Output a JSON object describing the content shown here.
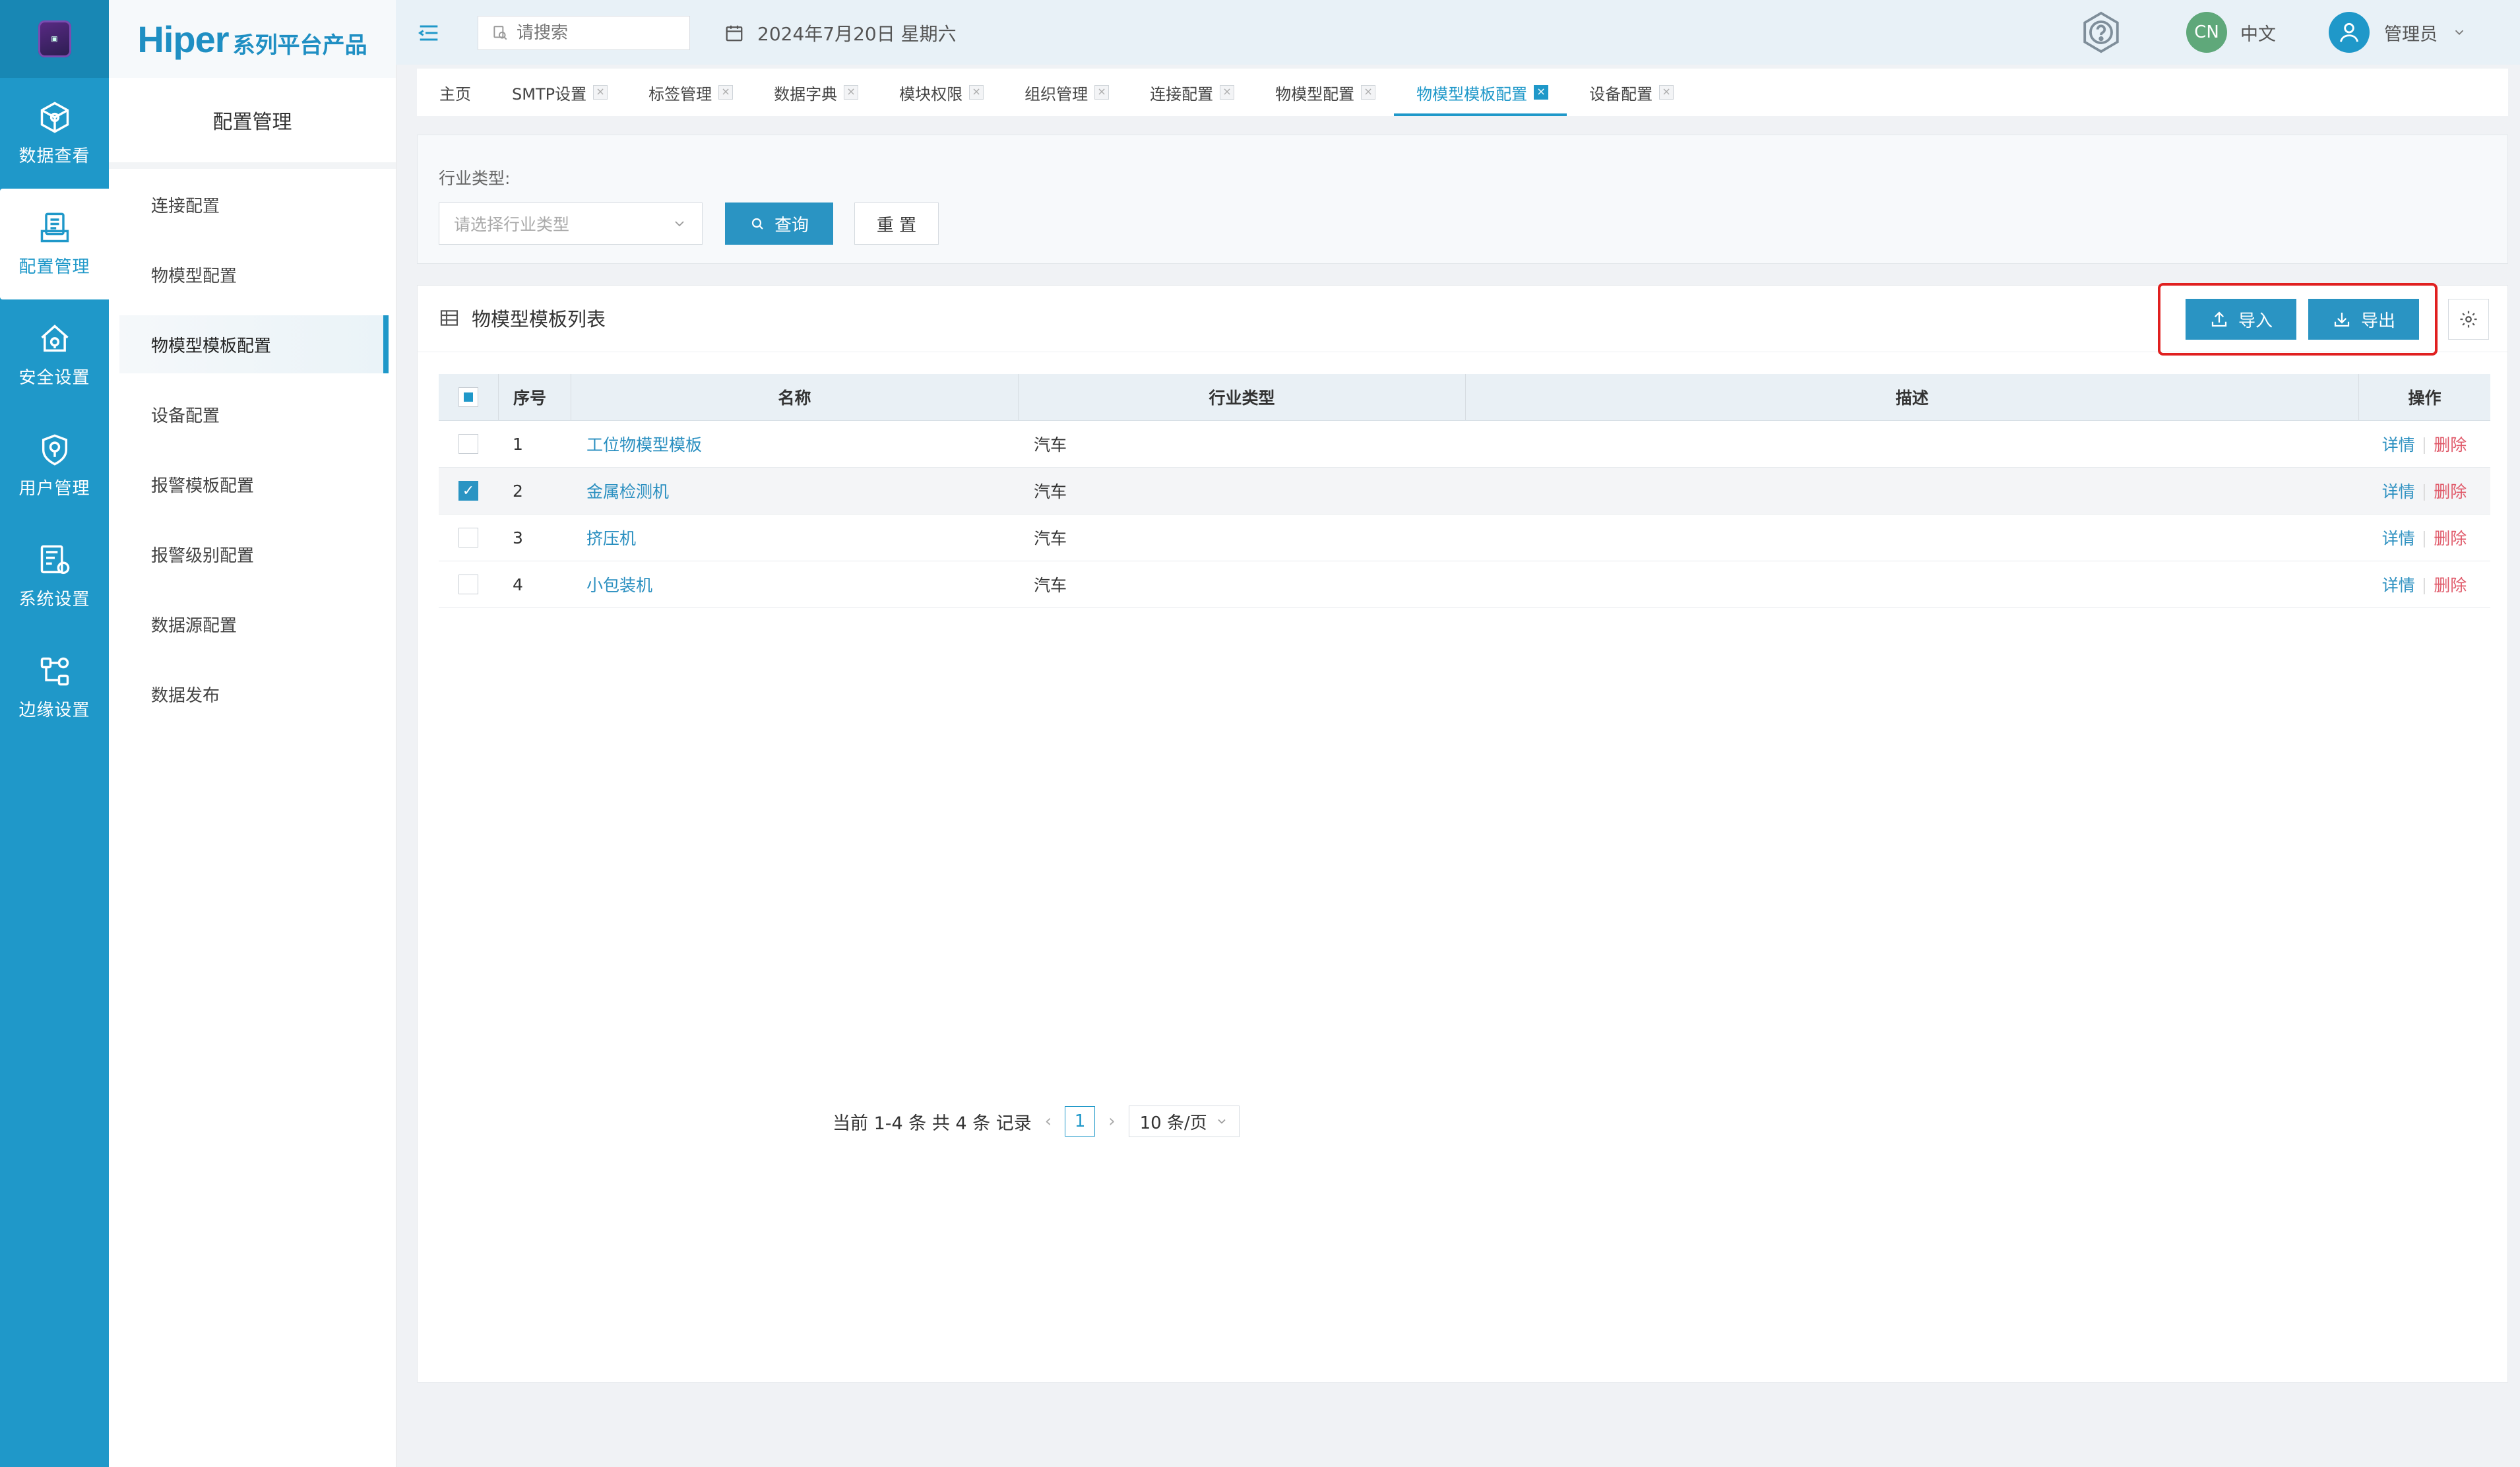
{
  "header": {
    "search_placeholder": "请搜索",
    "date": "2024年7月20日 星期六",
    "lang_badge": "CN",
    "lang_label": "中文",
    "user_label": "管理员"
  },
  "rail": [
    {
      "label": "数据查看",
      "icon": "cube-icon"
    },
    {
      "label": "配置管理",
      "icon": "config-doc-icon"
    },
    {
      "label": "安全设置",
      "icon": "security-house-icon"
    },
    {
      "label": "用户管理",
      "icon": "user-shield-icon"
    },
    {
      "label": "系统设置",
      "icon": "system-settings-icon"
    },
    {
      "label": "边缘设置",
      "icon": "edge-nodes-icon"
    }
  ],
  "brand": {
    "main": "Hiper",
    "sub": "系列平台产品"
  },
  "sidebar": {
    "title": "配置管理",
    "items": [
      "连接配置",
      "物模型配置",
      "物模型模板配置",
      "设备配置",
      "报警模板配置",
      "报警级别配置",
      "数据源配置",
      "数据发布"
    ]
  },
  "tabs": [
    "主页",
    "SMTP设置",
    "标签管理",
    "数据字典",
    "模块权限",
    "组织管理",
    "连接配置",
    "物模型配置",
    "物模型模板配置",
    "设备配置"
  ],
  "filter": {
    "label": "行业类型:",
    "placeholder": "请选择行业类型",
    "query_label": "查询",
    "reset_label": "重 置"
  },
  "list": {
    "title": "物模型模板列表",
    "import_label": "导入",
    "export_label": "导出",
    "columns": [
      "序号",
      "名称",
      "行业类型",
      "描述",
      "操作"
    ],
    "rows": [
      {
        "idx": "1",
        "name": "工位物模型模板",
        "industry": "汽车",
        "desc": "",
        "detail": "详情",
        "delete": "删除",
        "checked": false
      },
      {
        "idx": "2",
        "name": "金属检测机",
        "industry": "汽车",
        "desc": "",
        "detail": "详情",
        "delete": "删除",
        "checked": true
      },
      {
        "idx": "3",
        "name": "挤压机",
        "industry": "汽车",
        "desc": "",
        "detail": "详情",
        "delete": "删除",
        "checked": false
      },
      {
        "idx": "4",
        "name": "小包装机",
        "industry": "汽车",
        "desc": "",
        "detail": "详情",
        "delete": "删除",
        "checked": false
      }
    ]
  },
  "pagination": {
    "summary": "当前 1-4 条 共 4 条 记录",
    "current_page": "1",
    "page_size": "10 条/页"
  },
  "colors": {
    "brand": "#1f98c9",
    "highlight": "#e02020",
    "delete": "#e05a6a"
  }
}
